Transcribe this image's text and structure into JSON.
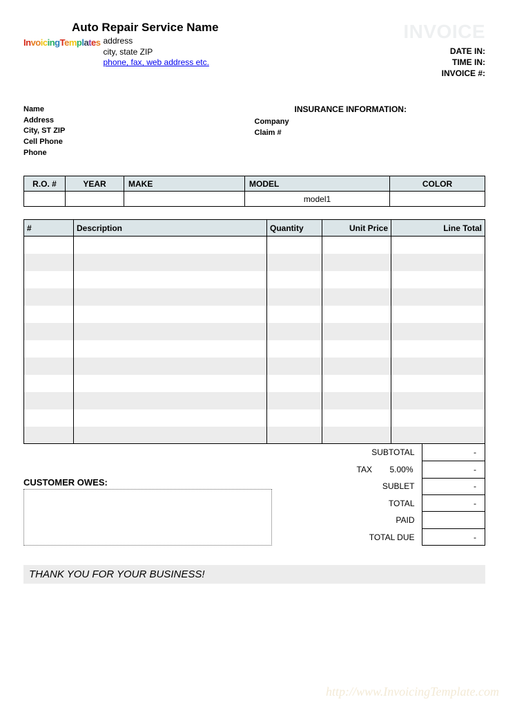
{
  "header": {
    "company_name": "Auto Repair Service Name",
    "address1": "address",
    "address2": "city, state ZIP",
    "contact_link": "phone, fax, web address etc.",
    "invoice_title": "INVOICE",
    "meta": {
      "date_in_label": "DATE IN:",
      "time_in_label": "TIME IN:",
      "invoice_num_label": "INVOICE #:"
    }
  },
  "customer": {
    "name_label": "Name",
    "address_label": "Address",
    "city_label": "City, ST ZIP",
    "cell_label": "Cell Phone",
    "phone_label": "Phone"
  },
  "insurance": {
    "title": "INSURANCE INFORMATION:",
    "company_label": "Company",
    "claim_label": "Claim #"
  },
  "vehicle": {
    "headers": {
      "ro": "R.O. #",
      "year": "YEAR",
      "make": "MAKE",
      "model": "MODEL",
      "color": "COLOR"
    },
    "values": {
      "ro": "",
      "year": "",
      "make": "",
      "model": "model1",
      "color": ""
    }
  },
  "items": {
    "headers": {
      "num": "#",
      "desc": "Description",
      "qty": "Quantity",
      "unit": "Unit Price",
      "total": "Line Total"
    },
    "row_count": 12
  },
  "totals": {
    "subtotal_label": "SUBTOTAL",
    "subtotal_value": "-",
    "tax_label": "TAX",
    "tax_pct": "5.00%",
    "tax_value": "-",
    "sublet_label": "SUBLET",
    "sublet_value": "-",
    "total_label": "TOTAL",
    "total_value": "-",
    "paid_label": "PAID",
    "due_label": "TOTAL DUE",
    "due_value": "-"
  },
  "customer_owes_label": "CUSTOMER OWES:",
  "thanks": "THANK YOU FOR YOUR BUSINESS!",
  "watermark": "http://www.InvoicingTemplate.com"
}
